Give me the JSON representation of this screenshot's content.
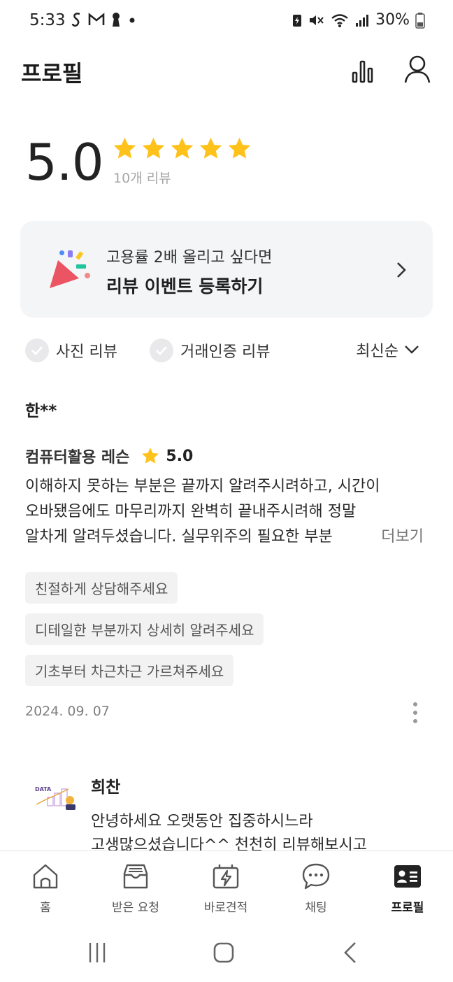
{
  "status_bar": {
    "time": "5:33",
    "battery": "30%"
  },
  "header": {
    "title": "프로필"
  },
  "rating": {
    "score": "5.0",
    "stars": 5,
    "count_label": "10개 리뷰",
    "star_color": "#FFC21A"
  },
  "promo": {
    "subtitle": "고용률 2배 올리고 싶다면",
    "title": "리뷰 이벤트 등록하기"
  },
  "filters": {
    "photo_review": "사진 리뷰",
    "verified_review": "거래인증 리뷰",
    "sort_label": "최신순"
  },
  "review": {
    "reviewer": "한**",
    "service": "컴퓨터활용 레슨",
    "score": "5.0",
    "lines": [
      "이해하지 못하는 부분은 끝까지 알려주시려하고, 시간이",
      "오바됐음에도 마무리까지 완벽히 끝내주시려해 정말",
      "알차게 알려두셨습니다. 실무위주의 필요한 부분"
    ],
    "more_label": "더보기",
    "tags": [
      "친절하게 상담해주세요",
      "디테일한 부분까지 상세히 알려주세요",
      "기초부터 차근차근 가르쳐주세요"
    ],
    "date": "2024. 09. 07"
  },
  "reply": {
    "name": "희찬",
    "logo_text": "DATA",
    "lines": [
      "안녕하세요 오랫동안 집중하시느라",
      "고생많으셨습니다^^ 천천히 리뷰해보시고"
    ]
  },
  "bottom_nav": {
    "items": [
      {
        "label": "홈",
        "icon": "home-icon"
      },
      {
        "label": "받은 요청",
        "icon": "inbox-icon"
      },
      {
        "label": "바로견적",
        "icon": "quick-quote-icon"
      },
      {
        "label": "채팅",
        "icon": "chat-icon"
      },
      {
        "label": "프로필",
        "icon": "profile-card-icon"
      }
    ],
    "active": "프로필"
  }
}
